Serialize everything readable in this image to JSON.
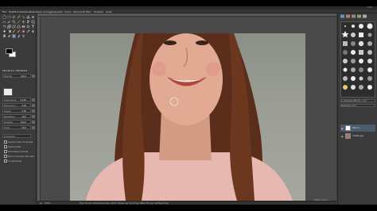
{
  "window": {
    "title": "GIMP"
  },
  "menu": {
    "items": [
      "File",
      "Modifica",
      "Seleziona",
      "Visualizza",
      "Immagine",
      "Livello",
      "Colori",
      "Strumenti",
      "Filtri",
      "Finestre",
      "Aiuto"
    ]
  },
  "tool_options": {
    "title": "Sfocatura / Nitidezza",
    "fields": [
      {
        "label": "Opacità",
        "value": "100,0"
      },
      {
        "label": "Pennello",
        "value": ""
      },
      {
        "label": "Dimensione",
        "value": "51,00"
      },
      {
        "label": "Proporzioni",
        "value": "0,00"
      },
      {
        "label": "Angolo",
        "value": "0,00"
      },
      {
        "label": "Spaziatura",
        "value": "10,0"
      },
      {
        "label": "Durezza",
        "value": "100,0"
      },
      {
        "label": "Forza",
        "value": "50,0"
      }
    ],
    "checks": [
      "Dinamiche",
      "Opzioni delle dinamiche",
      "Applica jitter",
      "Pennellata morbida",
      "Blocca pennello alla vista",
      "Incrementale"
    ]
  },
  "status": {
    "unit": "px",
    "zoom": "150%",
    "hint": "Fare clic per sfumare/rendere nitido; Maiusc per una linea retta; Ctrl per cambiare tipo"
  },
  "dock": {
    "brush_label": "2. Hardness 050 (51 × 51)",
    "spacing_label": "Spaziatura",
    "spacing_value": "10,0",
    "layers": [
      {
        "name": "Ritocco"
      },
      {
        "name": "ritratto.jpg"
      }
    ]
  },
  "footer": {
    "hint": "Cattura video..."
  }
}
